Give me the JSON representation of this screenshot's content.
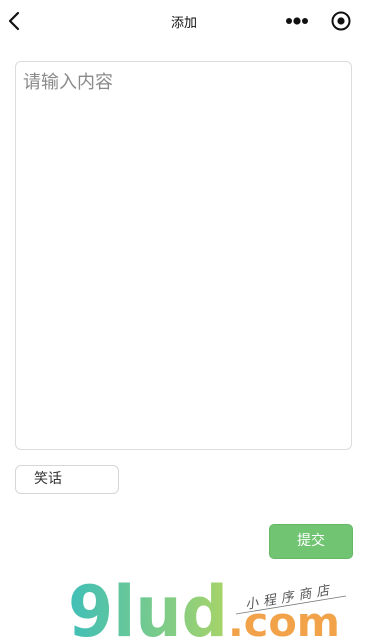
{
  "navbar": {
    "title": "添加",
    "back_icon": "chevron-left-icon",
    "more_icon": "more-dots-icon",
    "capsule_icon": "target-circle-icon"
  },
  "form": {
    "content_placeholder": "请输入内容",
    "content_value": "",
    "category_value": "笑话",
    "submit_label": "提交"
  },
  "watermark": {
    "brand": "9lud",
    "domain": ".com",
    "tagline": "小程序商店"
  },
  "colors": {
    "submit_bg": "#71c572",
    "watermark_gradient_start": "#3fbfb8",
    "watermark_gradient_end": "#a8d468",
    "watermark_orange": "#f2a34a"
  }
}
